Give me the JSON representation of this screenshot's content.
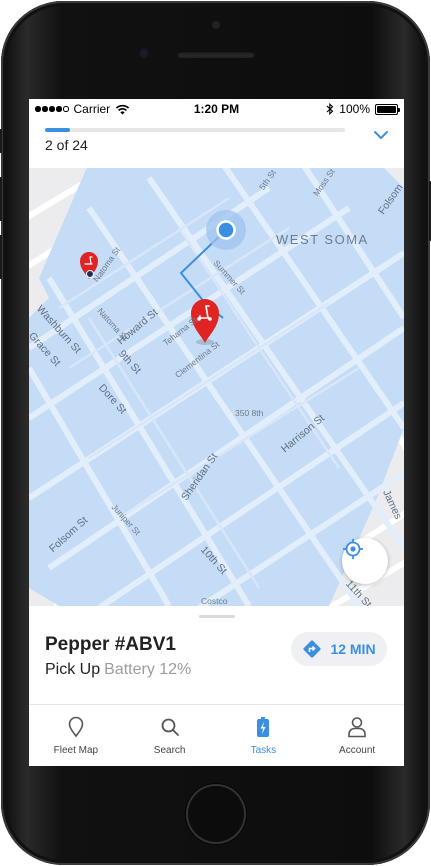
{
  "status_bar": {
    "carrier": "Carrier",
    "time": "1:20 PM",
    "battery_percent": "100%",
    "signal_icon": "signal-dots-icon",
    "wifi_icon": "wifi-icon",
    "bluetooth_icon": "bluetooth-icon"
  },
  "header": {
    "step_text": "2 of 24",
    "progress_fraction": 0.083,
    "collapse_icon": "chevron-down-icon"
  },
  "map": {
    "district_label": "WEST SOMA",
    "streets": {
      "fifth": "5th St",
      "moss": "Moss St",
      "folsom_top": "Folsom",
      "natoma_top": "Natoma St",
      "natoma": "Natoma St",
      "summer": "Summer St",
      "howard": "Howard St",
      "washburn": "Washburn St",
      "grace": "Grace St",
      "ninth": "9th St",
      "tehama": "Tehama St",
      "clementina": "Clementina St",
      "dore": "Dore St",
      "address": "350 8th",
      "harrison": "Harrison St",
      "sheridan": "Sheridan St",
      "juniper": "Juniper St",
      "folsom": "Folsom St",
      "tenth": "10th St",
      "costco": "Costco",
      "james": "James",
      "eleventh": "11th St"
    },
    "locate_icon": "crosshair-locate-icon"
  },
  "card": {
    "vehicle_name": "Pepper #ABV1",
    "task_type": "Pick Up",
    "battery": "Battery 12%",
    "eta": "12 MIN",
    "directions_icon": "directions-turn-icon"
  },
  "tabs": [
    {
      "label": "Fleet Map",
      "icon": "map-pin-icon",
      "active": false
    },
    {
      "label": "Search",
      "icon": "search-icon",
      "active": false
    },
    {
      "label": "Tasks",
      "icon": "battery-charge-icon",
      "active": true
    },
    {
      "label": "Account",
      "icon": "user-icon",
      "active": false
    }
  ],
  "colors": {
    "accent": "#3b8fe0",
    "zone_fill": "#c5dcf7",
    "marker_red": "#e02424"
  }
}
